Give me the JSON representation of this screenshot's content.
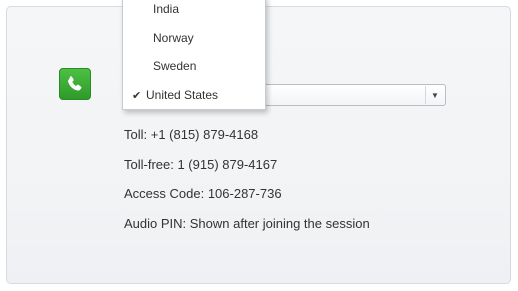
{
  "country_select": {
    "selected": "United States",
    "options": [
      "India",
      "Norway",
      "Sweden",
      "United States"
    ]
  },
  "dial_in": {
    "toll": "Toll: +1 (815) 879-4168",
    "toll_free": "Toll-free: 1 (915) 879-4167",
    "access_code": "Access Code: 106-287-736",
    "audio_pin": "Audio PIN: Shown after joining the session"
  },
  "icons": {
    "phone": "phone-icon",
    "check": "checkmark-icon",
    "arrow": "chevron-down-icon"
  },
  "colors": {
    "phone_icon_bg": "#3aa935",
    "text": "#333333"
  }
}
